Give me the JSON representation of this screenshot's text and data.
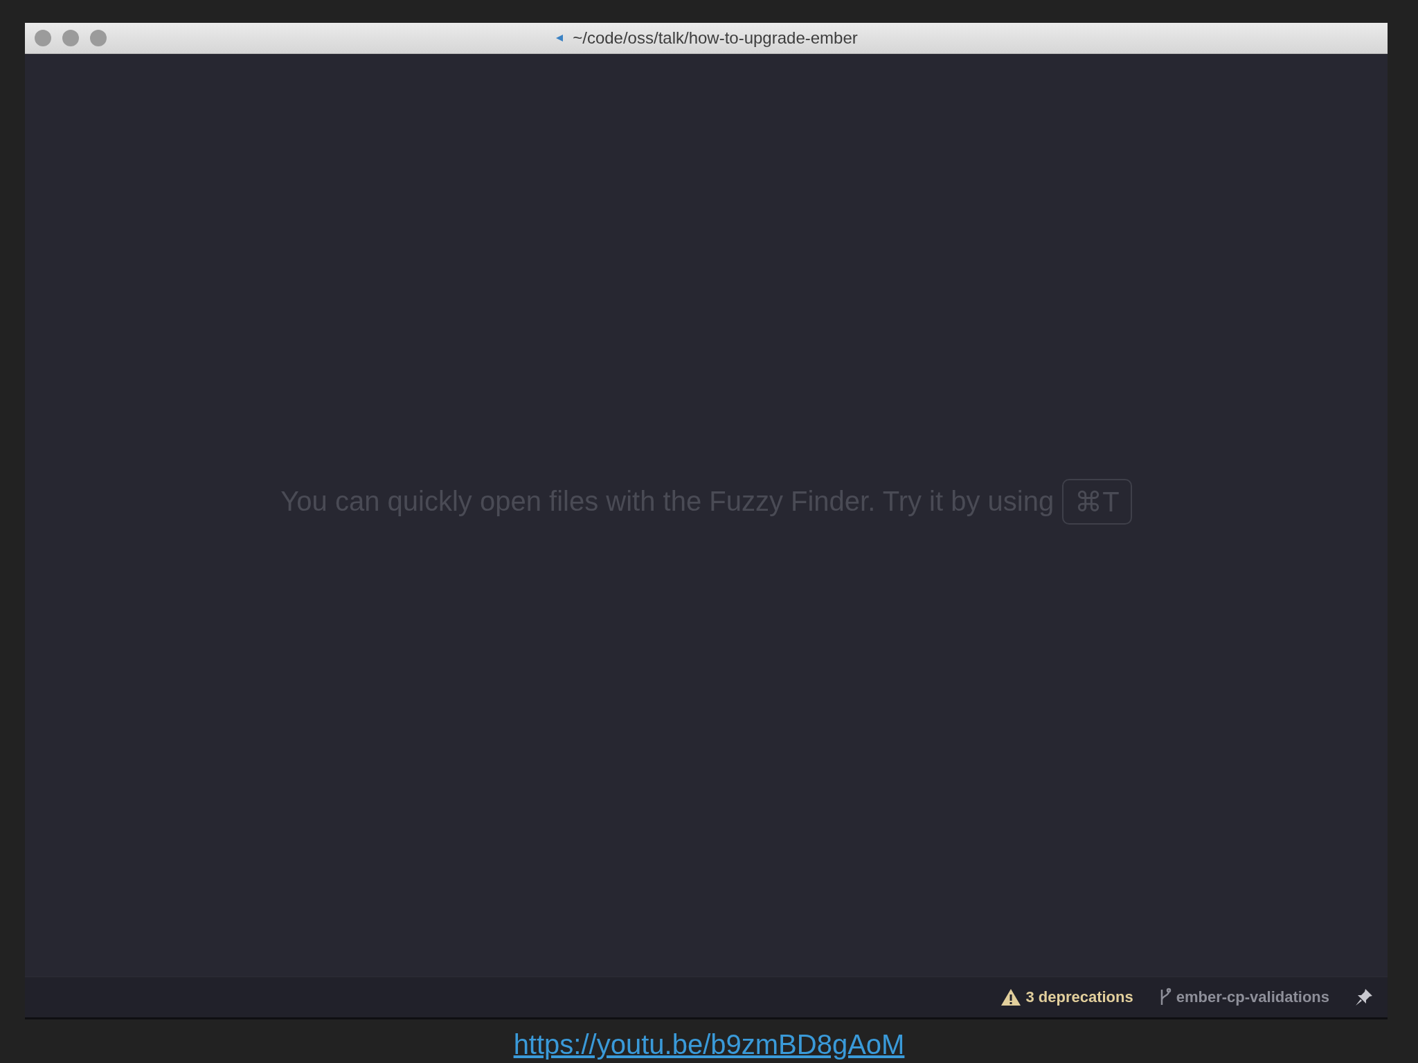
{
  "window": {
    "title": "~/code/oss/talk/how-to-upgrade-ember"
  },
  "editor": {
    "hint": "You can quickly open files with the Fuzzy Finder. Try it by using",
    "shortcut": "⌘T"
  },
  "status_bar": {
    "deprecations": "3 deprecations",
    "branch": "ember-cp-validations"
  },
  "link": "https://youtu.be/b9zmBD8gAoM"
}
